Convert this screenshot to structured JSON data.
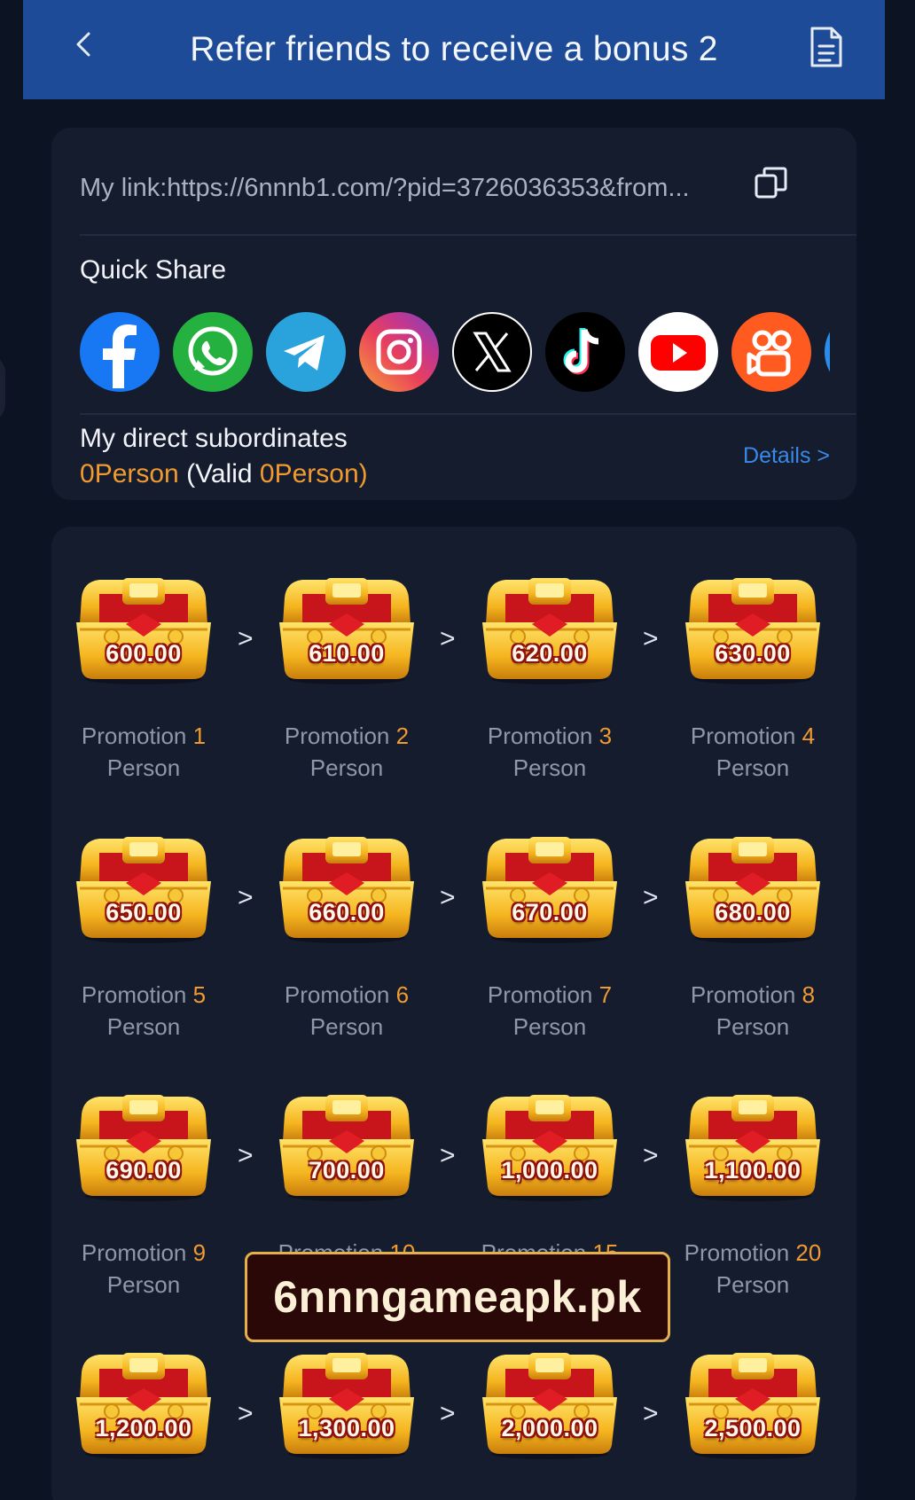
{
  "header": {
    "title": "Refer friends to receive a bonus 2"
  },
  "link": {
    "text": "My link:https://6nnnb1.com/?pid=3726036353&from..."
  },
  "quick_share": {
    "label": "Quick Share",
    "apps": [
      "facebook-icon",
      "whatsapp-icon",
      "telegram-icon",
      "instagram-icon",
      "x-icon",
      "tiktok-icon",
      "youtube-icon",
      "kuaishou-icon",
      "more-share-icon"
    ]
  },
  "subordinates": {
    "label": "My direct subordinates",
    "count": "0",
    "count_unit": "Person",
    "valid_prefix": "(Valid ",
    "valid_count": "0",
    "valid_suffix": "Person)",
    "details_link": "Details >"
  },
  "rewards": [
    {
      "amount": "600.00",
      "label": "Promotion",
      "num": "1",
      "unit": "Person"
    },
    {
      "amount": "610.00",
      "label": "Promotion",
      "num": "2",
      "unit": "Person"
    },
    {
      "amount": "620.00",
      "label": "Promotion",
      "num": "3",
      "unit": "Person"
    },
    {
      "amount": "630.00",
      "label": "Promotion",
      "num": "4",
      "unit": "Person"
    },
    {
      "amount": "650.00",
      "label": "Promotion",
      "num": "5",
      "unit": "Person"
    },
    {
      "amount": "660.00",
      "label": "Promotion",
      "num": "6",
      "unit": "Person"
    },
    {
      "amount": "670.00",
      "label": "Promotion",
      "num": "7",
      "unit": "Person"
    },
    {
      "amount": "680.00",
      "label": "Promotion",
      "num": "8",
      "unit": "Person"
    },
    {
      "amount": "690.00",
      "label": "Promotion",
      "num": "9",
      "unit": "Person"
    },
    {
      "amount": "700.00",
      "label": "Promotion",
      "num": "10",
      "unit": "Person"
    },
    {
      "amount": "1,000.00",
      "label": "Promotion",
      "num": "15",
      "unit": "Person"
    },
    {
      "amount": "1,100.00",
      "label": "Promotion",
      "num": "20",
      "unit": "Person"
    },
    {
      "amount": "1,200.00",
      "label": "",
      "num": "",
      "unit": ""
    },
    {
      "amount": "1,300.00",
      "label": "",
      "num": "",
      "unit": ""
    },
    {
      "amount": "2,000.00",
      "label": "",
      "num": "",
      "unit": ""
    },
    {
      "amount": "2,500.00",
      "label": "",
      "num": "",
      "unit": ""
    }
  ],
  "separator": ">",
  "watermark": "6nnngameapk.pk",
  "colors": {
    "header_bg": "#1d4b97",
    "accent_orange": "#f19a30",
    "link_blue": "#3a89e6"
  }
}
